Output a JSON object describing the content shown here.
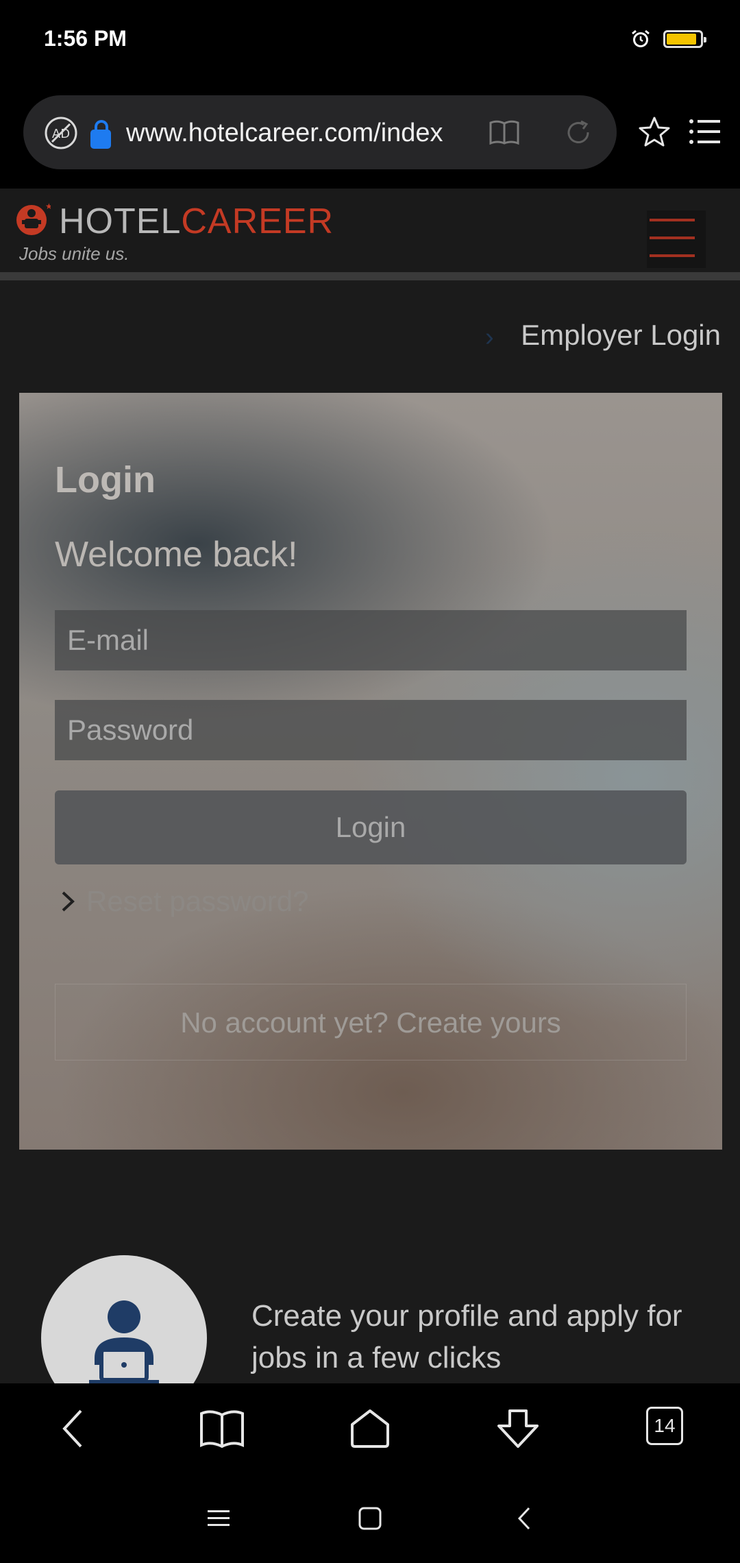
{
  "status": {
    "time": "1:56 PM",
    "battery_level": 0.9,
    "battery_color": "#f5c400"
  },
  "browser": {
    "url": "www.hotelcareer.com/index",
    "tab_count": "14",
    "lock_color": "#1e7bf0"
  },
  "site": {
    "logo_hotel": "HOTEL",
    "logo_career": "CAREER",
    "tagline": "Jobs unite us.",
    "brand_color": "#c43a24",
    "employer_login": "Employer Login"
  },
  "login": {
    "title": "Login",
    "subtitle": "Welcome back!",
    "email_placeholder": "E-mail",
    "password_placeholder": "Password",
    "button": "Login",
    "reset": "Reset password?",
    "create": "No account yet? Create yours"
  },
  "promo": {
    "text": "Create your profile and apply for jobs in a few clicks",
    "icon": "person-laptop-icon"
  },
  "icons": {
    "bottom_bar": [
      "back-icon",
      "bookmarks-icon",
      "home-icon",
      "download-icon",
      "tabs-icon"
    ],
    "system_nav": [
      "recents-icon",
      "home-nav-icon",
      "back-nav-icon"
    ]
  }
}
